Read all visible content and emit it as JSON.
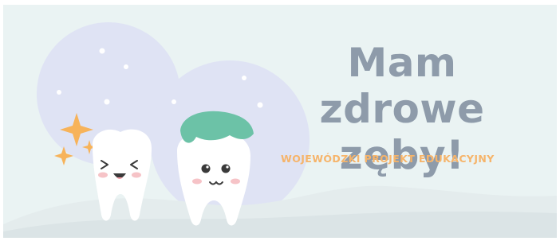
{
  "banner": {
    "title": "Mam zdrowe zęby!",
    "subtitle": "WOJEWÓDZKI  PROJEKT EDUKACYJNY"
  },
  "colors": {
    "background": "#eaf3f3",
    "title": "#8e9baa",
    "subtitle": "#f6b46a",
    "tooth": "#ffffff",
    "toothpaste": "#6cc2a7",
    "sparkle": "#f7b35a",
    "bubble": "#dfe3f4"
  },
  "icons": [
    "sparkle-icon",
    "tooth-icon",
    "toothpaste-icon"
  ]
}
